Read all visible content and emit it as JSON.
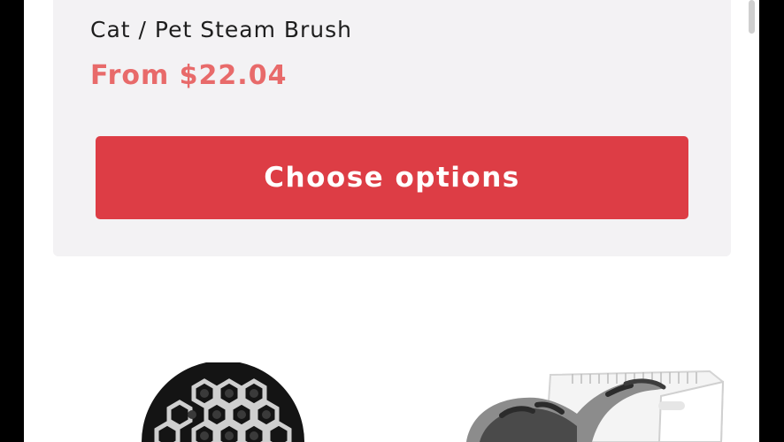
{
  "product": {
    "title": "Cat / Pet Steam Brush",
    "price": "From $22.04",
    "cta_label": "Choose options"
  },
  "colors": {
    "card_background": "#f3f2f4",
    "price": "#e86a6a",
    "button": "#dd3d45",
    "button_text": "#ffffff"
  },
  "next_product": {
    "image_icon": "cat-litter-box-image"
  }
}
